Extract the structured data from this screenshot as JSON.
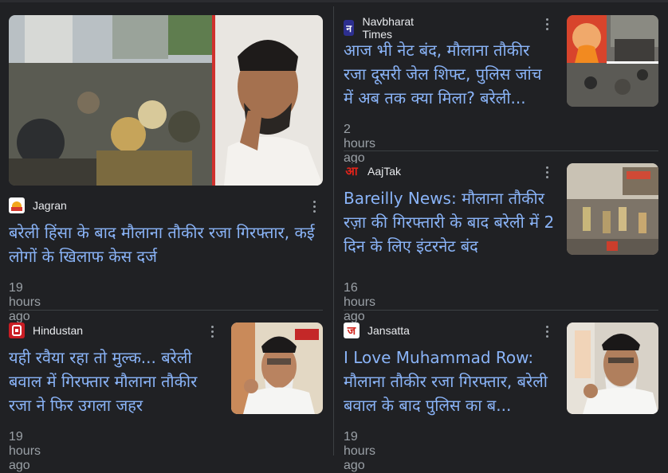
{
  "articles": [
    {
      "source": "Jagran",
      "logo_char": "",
      "title": "बरेली हिंसा के बाद मौलाना तौकीर रजा गिरफ्तार, कई लोगों के खिलाफ केस दर्ज",
      "time": "19 hours ago"
    },
    {
      "source": "Navbharat Times",
      "logo_char": "न",
      "title": "आज भी नेट बंद, मौलाना तौकीर रजा दूसरी जेल शिफ्ट, पुलिस जांच में अब तक क्या मिला? बरेली...",
      "time": "2 hours ago"
    },
    {
      "source": "AajTak",
      "logo_char": "आ",
      "title": "Bareilly News: मौलाना तौकीर रज़ा की गिरफ्तारी के बाद बरेली में 2 दिन के लिए इंटरनेट बंद",
      "time": "16 hours ago"
    },
    {
      "source": "Hindustan",
      "logo_char": "",
      "title": "यही रवैया रहा तो मुल्क... बरेली बवाल में गिरफ्तार मौलाना तौकीर रजा ने फिर उगला जहर",
      "time": "19 hours ago"
    },
    {
      "source": "Jansatta",
      "logo_char": "ज",
      "title": "I Love Muhammad Row: मौलाना तौकीर रजा गिरफ्तार, बरेली बवाल के बाद पुलिस का ब...",
      "time": "19 hours ago"
    }
  ],
  "colors": {
    "background": "#202124",
    "title": "#8ab4f8",
    "meta": "#9aa0a6",
    "source": "#e8eaed"
  }
}
